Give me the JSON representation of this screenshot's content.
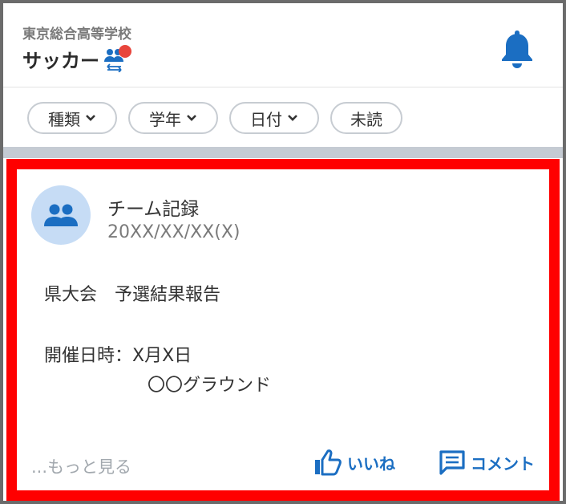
{
  "header": {
    "school_name": "東京総合高等学校",
    "club_name": "サッカー"
  },
  "filters": [
    {
      "label": "種類"
    },
    {
      "label": "学年"
    },
    {
      "label": "日付"
    },
    {
      "label": "未読"
    }
  ],
  "post": {
    "author": "チーム記録",
    "date": "20XX/XX/XX(X)",
    "title_line": "県大会　予選結果報告",
    "detail_line1": "開催日時：X月X日",
    "detail_line2": "〇〇グラウンド",
    "more_label": "...もっと見る",
    "like_label": "いいね",
    "comment_label": "コメント"
  },
  "colors": {
    "accent": "#1b6ec2",
    "highlight_border": "#ff0000",
    "badge": "#e8453c",
    "avatar_bg": "#c6dcf5"
  },
  "icons": {
    "club": "group-switch-icon",
    "notifications": "bell-icon",
    "author": "people-icon",
    "like": "thumbs-up-icon",
    "comment": "comment-icon"
  }
}
